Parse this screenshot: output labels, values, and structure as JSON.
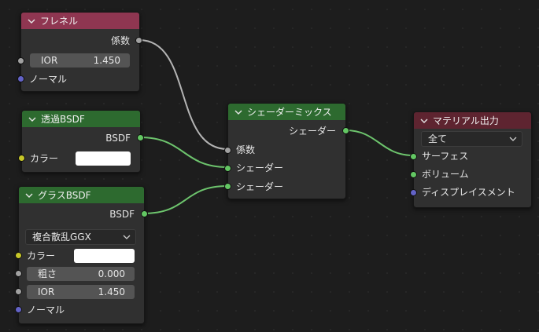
{
  "colors": {
    "canvas_bg": "#1d1d1d",
    "node_bg": "#303030",
    "header_fresnel": "#8f3651",
    "header_shader": "#2d6a2f",
    "header_output": "#5e2430",
    "socket_float": "#a1a1a1",
    "socket_shader": "#63c763",
    "socket_color": "#c7c729",
    "socket_vector": "#6363c7",
    "wire_shader": "#6dc46d",
    "wire_float": "#b4b4b4",
    "color_swatch": "#ffffff"
  },
  "nodes": {
    "fresnel": {
      "title": "フレネル",
      "out_fac": "係数",
      "ior_label": "IOR",
      "ior_value": "1.450",
      "normal": "ノーマル"
    },
    "transparent": {
      "title": "透過BSDF",
      "out_bsdf": "BSDF",
      "color_label": "カラー"
    },
    "glass": {
      "title": "グラスBSDF",
      "out_bsdf": "BSDF",
      "distribution": "複合散乱GGX",
      "color_label": "カラー",
      "roughness_label": "粗さ",
      "roughness_value": "0.000",
      "ior_label": "IOR",
      "ior_value": "1.450",
      "normal": "ノーマル"
    },
    "mix": {
      "title": "シェーダーミックス",
      "out_shader": "シェーダー",
      "in_fac": "係数",
      "in_shader1": "シェーダー",
      "in_shader2": "シェーダー"
    },
    "output": {
      "title": "マテリアル出力",
      "target": "全て",
      "in_surface": "サーフェス",
      "in_volume": "ボリューム",
      "in_displacement": "ディスプレイスメント"
    }
  }
}
